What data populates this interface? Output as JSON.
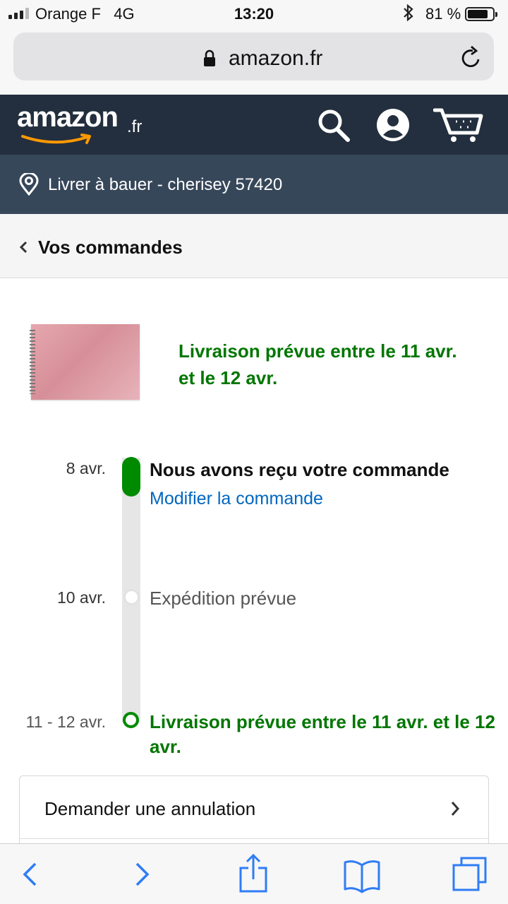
{
  "status_bar": {
    "carrier": "Orange F",
    "network": "4G",
    "time": "13:20",
    "battery_percent": "81 %",
    "battery_level": 0.81
  },
  "browser": {
    "url_domain": "amazon.fr"
  },
  "header": {
    "logo_text": "amazon",
    "logo_tld": ".fr"
  },
  "location": {
    "text": "Livrer à bauer - cherisey 57420"
  },
  "breadcrumb": {
    "back_label": "Vos commandes"
  },
  "product": {
    "status": "Livraison prévue entre le 11 avr. et le 12 avr."
  },
  "timeline": [
    {
      "date": "8 avr.",
      "title": "Nous avons reçu votre commande",
      "link": "Modifier la commande"
    },
    {
      "date": "10 avr.",
      "title": "Expédition prévue"
    },
    {
      "date": "11 - 12 avr.",
      "title": "Livraison prévue entre le 11 avr. et le 12 avr."
    }
  ],
  "actions": {
    "cancel_label": "Demander une annulation"
  },
  "colors": {
    "header_bg": "#232f3e",
    "location_bg": "#37475a",
    "accent_green": "#007600",
    "timeline_green": "#008a00",
    "link_blue": "#0066c0",
    "ios_blue": "#2f7cf6",
    "amazon_orange": "#ff9900"
  },
  "icons": {
    "lock": "lock-icon",
    "reload": "reload-icon",
    "search": "search-icon",
    "account": "account-icon",
    "cart": "cart-icon",
    "location": "location-pin-icon",
    "back": "chevron-left-icon",
    "forward_action": "chevron-right-icon",
    "share": "share-icon",
    "bookmarks": "book-icon",
    "tabs": "tabs-icon"
  }
}
